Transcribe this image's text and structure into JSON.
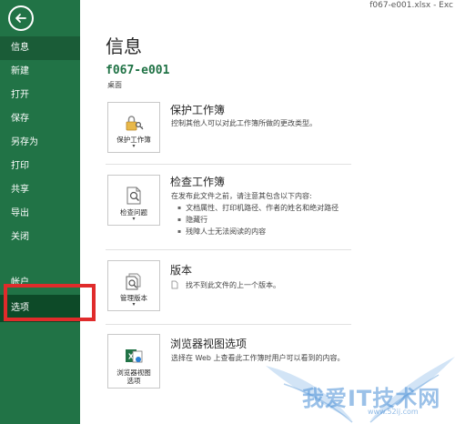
{
  "window": {
    "title_text": "f067-e001.xlsx - Exc"
  },
  "sidebar": {
    "items": [
      {
        "label": "信息",
        "state": "active"
      },
      {
        "label": "新建"
      },
      {
        "label": "打开"
      },
      {
        "label": "保存"
      },
      {
        "label": "另存为"
      },
      {
        "label": "打印"
      },
      {
        "label": "共享"
      },
      {
        "label": "导出"
      },
      {
        "label": "关闭"
      }
    ],
    "bottom_items": [
      {
        "label": "帐户"
      },
      {
        "label": "选项",
        "state": "highlighted"
      }
    ],
    "highlight_color": "#e02b2b",
    "bg_color": "#217346"
  },
  "main": {
    "page_title": "信息",
    "file_name": "f067-e001",
    "file_location": "桌面",
    "sections": [
      {
        "tile_label": "保护工作簿",
        "tile_caret": "▾",
        "icon": "lock-key-icon",
        "title": "保护工作簿",
        "description": "控制其他人可以对此工作簿所做的更改类型。"
      },
      {
        "tile_label": "检查问题",
        "tile_caret": "▾",
        "icon": "inspect-document-icon",
        "title": "检查工作簿",
        "description": "在发布此文件之前，请注意其包含以下内容:",
        "bullets": [
          "文档属性、打印机路径、作者的姓名和绝对路径",
          "隐藏行",
          "残障人士无法阅读的内容"
        ]
      },
      {
        "tile_label": "管理版本",
        "tile_caret": "▾",
        "icon": "manage-versions-icon",
        "title": "版本",
        "description": "找不到此文件的上一个版本。"
      },
      {
        "tile_label_line1": "浏览器视图",
        "tile_label_line2": "选项",
        "icon": "browser-view-icon",
        "title": "浏览器视图选项",
        "description": "选择在 Web 上查看此工作簿时用户可以看到的内容。"
      }
    ]
  },
  "watermark": {
    "text": "我爱IT技术网",
    "url": "www.52ij.com"
  }
}
